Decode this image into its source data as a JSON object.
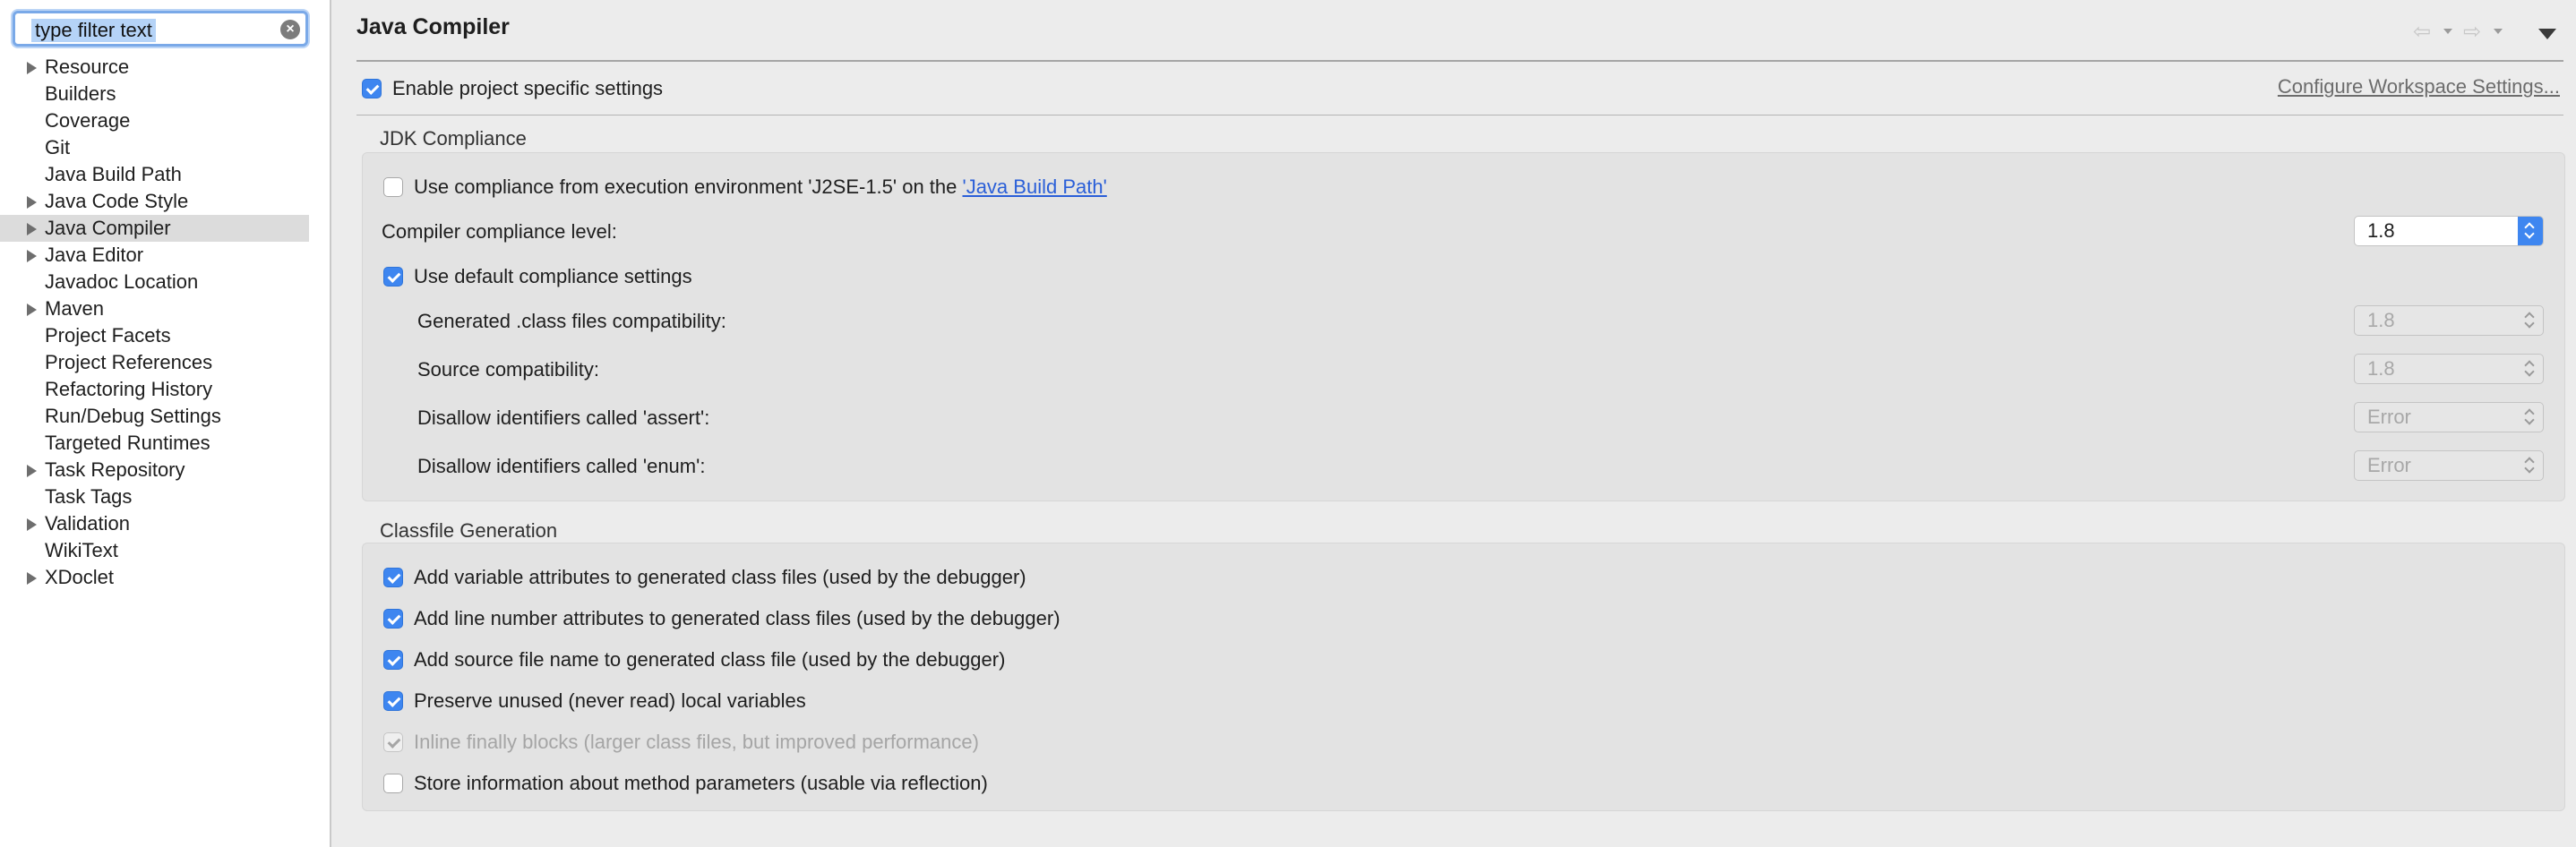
{
  "sidebar": {
    "filter_text": "type filter text",
    "items": [
      {
        "label": "Resource",
        "expandable": true
      },
      {
        "label": "Builders",
        "expandable": false
      },
      {
        "label": "Coverage",
        "expandable": false
      },
      {
        "label": "Git",
        "expandable": false
      },
      {
        "label": "Java Build Path",
        "expandable": false
      },
      {
        "label": "Java Code Style",
        "expandable": true
      },
      {
        "label": "Java Compiler",
        "expandable": true,
        "selected": true
      },
      {
        "label": "Java Editor",
        "expandable": true
      },
      {
        "label": "Javadoc Location",
        "expandable": false
      },
      {
        "label": "Maven",
        "expandable": true
      },
      {
        "label": "Project Facets",
        "expandable": false
      },
      {
        "label": "Project References",
        "expandable": false
      },
      {
        "label": "Refactoring History",
        "expandable": false
      },
      {
        "label": "Run/Debug Settings",
        "expandable": false
      },
      {
        "label": "Targeted Runtimes",
        "expandable": false
      },
      {
        "label": "Task Repository",
        "expandable": true
      },
      {
        "label": "Task Tags",
        "expandable": false
      },
      {
        "label": "Validation",
        "expandable": true
      },
      {
        "label": "WikiText",
        "expandable": false
      },
      {
        "label": "XDoclet",
        "expandable": true
      }
    ]
  },
  "header": {
    "title": "Java Compiler",
    "icons": [
      "back-arrow-icon",
      "forward-arrow-icon",
      "view-menu-icon"
    ]
  },
  "project_settings": {
    "enable_label": "Enable project specific settings",
    "enable_checked": true,
    "configure_workspace_link": "Configure Workspace Settings..."
  },
  "jdk": {
    "title": "JDK Compliance",
    "use_env_prefix": "Use compliance from execution environment 'J2SE-1.5' on the ",
    "use_env_link": "'Java Build Path'",
    "use_env_checked": false,
    "compliance_label": "Compiler compliance level:",
    "compliance_value": "1.8",
    "use_default_label": "Use default compliance settings",
    "use_default_checked": true,
    "class_compat_label": "Generated .class files compatibility:",
    "class_compat_value": "1.8",
    "source_compat_label": "Source compatibility:",
    "source_compat_value": "1.8",
    "assert_label": "Disallow identifiers called 'assert':",
    "assert_value": "Error",
    "enum_label": "Disallow identifiers called 'enum':",
    "enum_value": "Error"
  },
  "classfile": {
    "title": "Classfile Generation",
    "options": [
      {
        "label": "Add variable attributes to generated class files (used by the debugger)",
        "state": "on"
      },
      {
        "label": "Add line number attributes to generated class files (used by the debugger)",
        "state": "on"
      },
      {
        "label": "Add source file name to generated class file (used by the debugger)",
        "state": "on"
      },
      {
        "label": "Preserve unused (never read) local variables",
        "state": "on"
      },
      {
        "label": "Inline finally blocks (larger class files, but improved performance)",
        "state": "disabled"
      },
      {
        "label": "Store information about method parameters (usable via reflection)",
        "state": "off"
      }
    ]
  },
  "colors": {
    "accent": "#3e86f0",
    "selection": "#dcdcdc",
    "link": "#2a5fd8"
  }
}
